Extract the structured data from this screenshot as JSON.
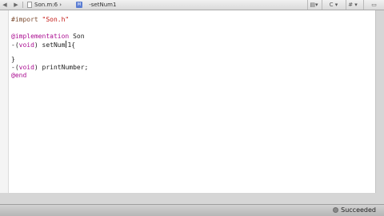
{
  "jump_bar": {
    "back_icon": "chevron-left-icon",
    "forward_icon": "chevron-right-icon",
    "file_label": "Son.m:6",
    "file_icon": "file-icon",
    "symbol_icon": "method-icon",
    "symbol_badge": "M",
    "symbol_label": "-setNum1",
    "buttons": [
      {
        "name": "related-files-button",
        "icon": "document-icon",
        "label": "▤▾"
      },
      {
        "name": "counterparts-button",
        "icon": "c-icon",
        "label": "C ▾"
      },
      {
        "name": "includes-button",
        "icon": "hash-icon",
        "label": "# ▾"
      },
      {
        "name": "split-editor-button",
        "icon": "split-icon",
        "label": "▭"
      }
    ]
  },
  "editor": {
    "lines": [
      {
        "directive": "#import ",
        "string": "\"Son.h\""
      },
      {
        "text": ""
      },
      {
        "directive": "@implementation",
        "name": " Son"
      },
      {
        "before": "-(",
        "keyword": "void",
        "mid": ") setNum",
        "after": "1{"
      },
      {
        "text": ""
      },
      {
        "text": "}"
      },
      {
        "before": "-(",
        "keyword": "void",
        "mid": ") printNumber;"
      },
      {
        "directive": "@end"
      }
    ]
  },
  "status": {
    "icon": "status-dot-icon",
    "label": "Succeeded"
  }
}
